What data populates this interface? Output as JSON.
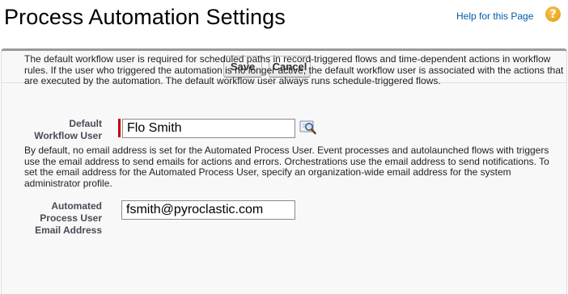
{
  "header": {
    "title": "Process Automation Settings",
    "help_link": "Help for this Page",
    "help_icon": "question-mark-icon",
    "help_icon_glyph": "?"
  },
  "toolbar": {
    "save_label": "Save",
    "cancel_label": "Cancel"
  },
  "workflow_user": {
    "description": "The default workflow user is required for scheduled paths in record-triggered flows and time-dependent actions in workflow rules. If the user who triggered the automation is no longer active, the default workflow user is associated with the actions that are executed by the automation. The default workflow user always runs schedule-triggered flows.",
    "label": "Default Workflow User",
    "value": "Flo Smith",
    "lookup_icon": "lookup-magnifier-icon"
  },
  "automated_process_user": {
    "description": "By default, no email address is set for the Automated Process User. Event processes and autolaunched flows with triggers use the email address to send emails for actions and errors. Orchestrations use the email address to send notifications. To set the email address for the Automated Process User, specify an organization-wide email address for the system administrator profile.",
    "label": "Automated Process User Email Address",
    "value": "fsmith@pyroclastic.com"
  },
  "colors": {
    "link": "#015ba7",
    "required_bar": "#c00000",
    "help_icon": "#e39a0b",
    "panel_top_border": "#9a9a9a"
  }
}
